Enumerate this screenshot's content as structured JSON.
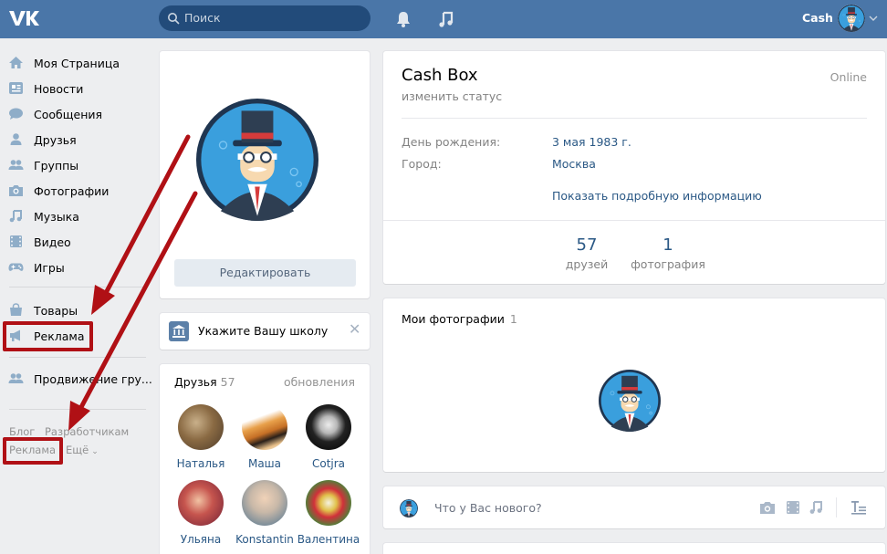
{
  "header": {
    "search_placeholder": "Поиск",
    "user_name": "Cash"
  },
  "menu": {
    "items": [
      {
        "label": "Моя Страница",
        "icon": "home-icon"
      },
      {
        "label": "Новости",
        "icon": "news-icon"
      },
      {
        "label": "Сообщения",
        "icon": "messages-icon"
      },
      {
        "label": "Друзья",
        "icon": "friend-icon"
      },
      {
        "label": "Группы",
        "icon": "groups-icon"
      },
      {
        "label": "Фотографии",
        "icon": "camera-icon"
      },
      {
        "label": "Музыка",
        "icon": "music-icon"
      },
      {
        "label": "Видео",
        "icon": "video-icon"
      },
      {
        "label": "Игры",
        "icon": "gamepad-icon"
      },
      {
        "label": "Товары",
        "icon": "bag-icon"
      },
      {
        "label": "Реклама",
        "icon": "megaphone-icon"
      },
      {
        "label": "Продвижение гру...",
        "icon": "promote-icon"
      }
    ],
    "footer": {
      "blog": "Блог",
      "developers": "Разработчикам",
      "ads": "Реклама",
      "more": "Ещё"
    }
  },
  "profile_card": {
    "edit_label": "Редактировать"
  },
  "school": {
    "label": "Укажите Вашу школу"
  },
  "friends": {
    "title": "Друзья",
    "count": "57",
    "updates": "обновления",
    "list": [
      {
        "name": "Наталья"
      },
      {
        "name": "Маша"
      },
      {
        "name": "Cotjra"
      },
      {
        "name": "Ульяна"
      },
      {
        "name": "Konstantin"
      },
      {
        "name": "Валентина"
      }
    ]
  },
  "profile": {
    "name": "Cash Box",
    "status": "изменить статус",
    "online": "Online",
    "birthday_label": "День рождения:",
    "birthday_value": "3 мая 1983 г.",
    "city_label": "Город:",
    "city_value": "Москва",
    "more_info": "Показать подробную информацию",
    "stats": [
      {
        "value": "57",
        "label": "друзей"
      },
      {
        "value": "1",
        "label": "фотография"
      }
    ]
  },
  "photos": {
    "title": "Мои фотографии",
    "count": "1"
  },
  "post": {
    "placeholder": "Что у Вас нового?"
  },
  "colors": {
    "header": "#4a76a8",
    "link": "#2a5885",
    "highlight": "#b01015"
  }
}
